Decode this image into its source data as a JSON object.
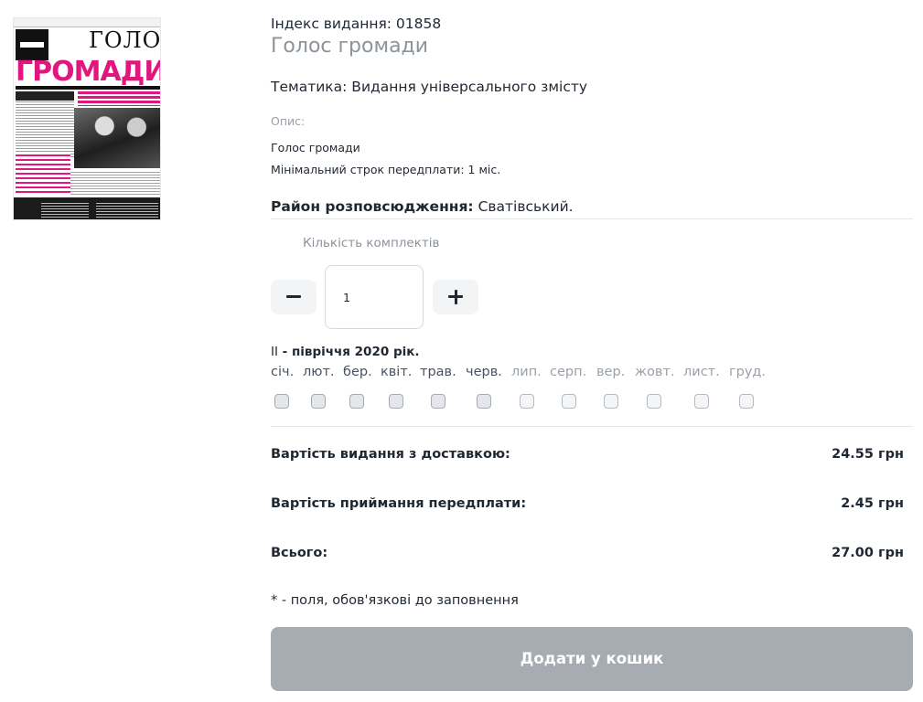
{
  "product": {
    "index_label": "Індекс видання: 01858",
    "title": "Голос громади",
    "theme": "Тематика: Видання універсального змісту",
    "description_label": "Опис:",
    "description_line1": "Голос громади",
    "description_line2": "Мінімальний строк передплати: 1 міс.",
    "district_label": "Район розповсюдження:",
    "district_value": " Сватівський."
  },
  "cover": {
    "masthead_small": "ГОЛОС",
    "masthead_big": "ГРОМАДИ",
    "brand_color": "#e0177f"
  },
  "quantity": {
    "label": "Кількість комплектів",
    "value": "1",
    "minus_icon": "minus-icon",
    "plus_icon": "plus-icon"
  },
  "period": {
    "roman": "II",
    "text": " - півріччя 2020 рік."
  },
  "months": [
    {
      "label": "січ.",
      "available": true,
      "checked": false
    },
    {
      "label": "лют.",
      "available": true,
      "checked": false
    },
    {
      "label": "бер.",
      "available": true,
      "checked": false
    },
    {
      "label": "квіт.",
      "available": true,
      "checked": false
    },
    {
      "label": "трав.",
      "available": true,
      "checked": false
    },
    {
      "label": "черв.",
      "available": true,
      "checked": false
    },
    {
      "label": "лип.",
      "available": false,
      "checked": false
    },
    {
      "label": "серп.",
      "available": false,
      "checked": false
    },
    {
      "label": "вер.",
      "available": false,
      "checked": false
    },
    {
      "label": "жовт.",
      "available": false,
      "checked": false
    },
    {
      "label": "лист.",
      "available": false,
      "checked": false
    },
    {
      "label": "груд.",
      "available": false,
      "checked": false
    }
  ],
  "costs": {
    "delivery_label": "Вартість видання з доставкою:",
    "delivery_value": "24.55 грн",
    "acceptance_label": "Вартість приймання передплати:",
    "acceptance_value": "2.45 грн",
    "total_label": "Всього:",
    "total_value": "27.00 грн"
  },
  "required_note": "* - поля, обов'язкові до заповнення",
  "add_to_cart_label": "Додати у кошик",
  "colors": {
    "button_disabled": "#a7abb2",
    "text_primary": "#1f2733",
    "text_muted": "#8d939b"
  }
}
